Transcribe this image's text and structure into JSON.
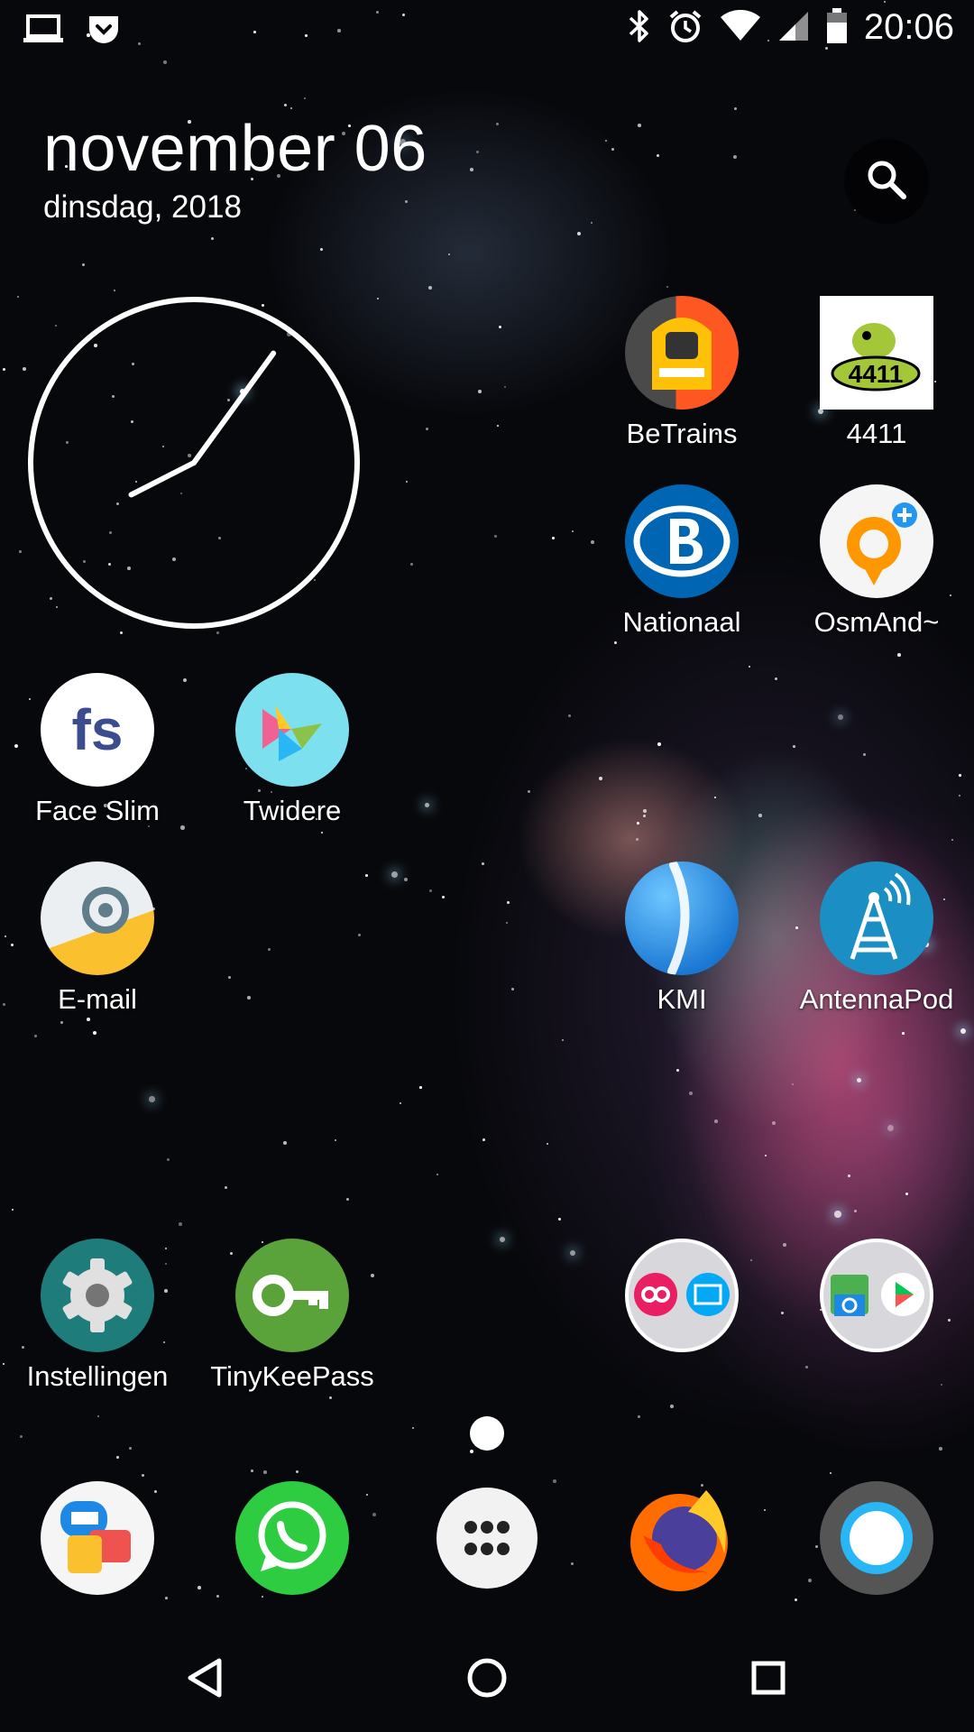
{
  "status_bar": {
    "left_icons": [
      "laptop-icon",
      "pocket-shield-icon"
    ],
    "right_icons": [
      "bluetooth-icon",
      "alarm-icon",
      "wifi-icon",
      "cell-signal-icon",
      "battery-icon"
    ],
    "time": "20:06"
  },
  "date_widget": {
    "title": "november 06",
    "subtitle": "dinsdag, 2018"
  },
  "search": {
    "icon": "search-icon"
  },
  "clock": {
    "type": "analog-clock",
    "hour": 20,
    "minute": 6
  },
  "apps": {
    "betrains": "BeTrains",
    "app4411": "4411",
    "app4411_logo_text": "4411",
    "nationaal": "Nationaal",
    "osmand": "OsmAnd~",
    "faceslim": "Face Slim",
    "faceslim_logo_text": "fs",
    "twidere": "Twidere",
    "email": "E-mail",
    "kmi": "KMI",
    "antennapod": "AntennaPod",
    "instellingen": "Instellingen",
    "tinykeepass": "TinyKeePass"
  },
  "folders": {
    "folder1_icons": [
      "infinity-app-icon",
      "kbc-wallet-icon"
    ],
    "folder2_icons": [
      "android-camera-icon",
      "play-store-icon"
    ]
  },
  "dock": [
    "messages-icon",
    "whatsapp-icon",
    "app-drawer-icon",
    "firefox-icon",
    "camera-shutter-icon"
  ],
  "navigation": [
    "back-button",
    "home-button",
    "recents-button"
  ],
  "colors": {
    "whatsapp": "#2ecc40",
    "instellingen": "#1e7d7a",
    "tinykeepass": "#5aa33a",
    "nmbs_blue": "#0066b3",
    "antennapod": "#1b8fc4"
  }
}
